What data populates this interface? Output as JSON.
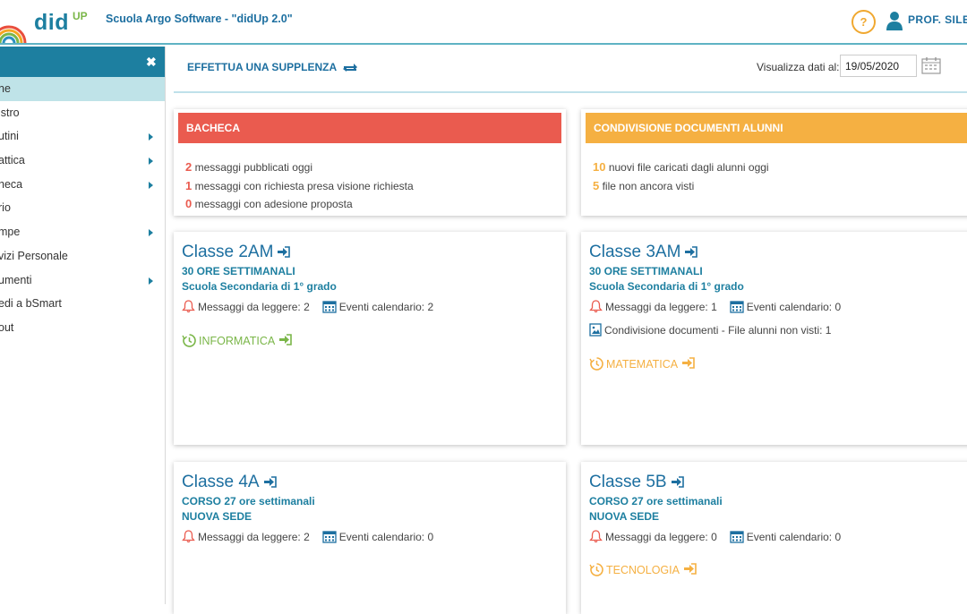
{
  "header": {
    "logo_text": "did",
    "logo_sup": "UP",
    "school": "Scuola Argo Software - \"didUp 2.0\"",
    "help": "?",
    "user": "PROF. SILE"
  },
  "sidebar": {
    "close": "✖",
    "items": [
      {
        "label": "ne",
        "submenu": false
      },
      {
        "label": "istro",
        "submenu": false
      },
      {
        "label": "utini",
        "submenu": true
      },
      {
        "label": "attica",
        "submenu": true
      },
      {
        "label": "heca",
        "submenu": true
      },
      {
        "label": "rio",
        "submenu": false
      },
      {
        "label": "mpe",
        "submenu": true
      },
      {
        "label": "vizi Personale",
        "submenu": false
      },
      {
        "label": "umenti",
        "submenu": true
      },
      {
        "label": "edi a bSmart",
        "submenu": false
      },
      {
        "label": "out",
        "submenu": false
      }
    ]
  },
  "toolbar": {
    "substitution": "EFFETTUA UNA SUPPLENZA",
    "date_label": "Visualizza dati al:",
    "date_value": "19/05/2020"
  },
  "colors": {
    "red": "#ea5b4f",
    "orange": "#f5b042",
    "blue": "#1d6fa0",
    "green": "#7ab648"
  },
  "bacheca": {
    "title": "BACHECA",
    "lines": [
      {
        "num": "2",
        "text": "messaggi pubblicati oggi"
      },
      {
        "num": "1",
        "text": "messaggi con richiesta presa visione richiesta"
      },
      {
        "num": "0",
        "text": "messaggi con adesione proposta"
      }
    ]
  },
  "condivisione": {
    "title": "CONDIVISIONE DOCUMENTI ALUNNI",
    "lines": [
      {
        "num": "10",
        "text": "nuovi file caricati dagli alunni oggi"
      },
      {
        "num": "5",
        "text": "file non ancora visti"
      }
    ]
  },
  "classes": [
    {
      "title": "Classe 2AM",
      "sub1": "30 ORE SETTIMANALI",
      "sub2": "Scuola Secondaria di 1° grado",
      "messages": "Messaggi da leggere: 2",
      "events": "Eventi calendario: 2",
      "docs": "",
      "subject": "INFORMATICA"
    },
    {
      "title": "Classe 3AM",
      "sub1": "30 ORE SETTIMANALI",
      "sub2": "Scuola Secondaria di 1° grado",
      "messages": "Messaggi da leggere: 1",
      "events": "Eventi calendario: 0",
      "docs": "Condivisione documenti - File alunni non visti: 1",
      "subject": "MATEMATICA"
    },
    {
      "title": "Classe 4A",
      "sub1": "CORSO 27 ore settimanali",
      "sub2": "NUOVA SEDE",
      "messages": "Messaggi da leggere: 2",
      "events": "Eventi calendario: 0",
      "docs": "",
      "subject": ""
    },
    {
      "title": "Classe 5B",
      "sub1": "CORSO 27 ore settimanali",
      "sub2": "NUOVA SEDE",
      "messages": "Messaggi da leggere: 0",
      "events": "Eventi calendario: 0",
      "docs": "",
      "subject": "TECNOLOGIA"
    }
  ]
}
